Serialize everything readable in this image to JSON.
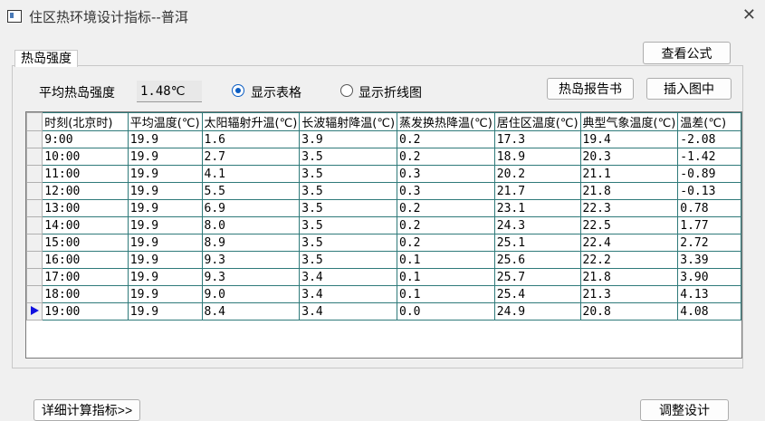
{
  "window": {
    "title": "住区热环境设计指标--普洱",
    "close_glyph": "✕"
  },
  "tab_label": "热岛强度",
  "avg_label": "平均热岛强度",
  "avg_value": "1.48℃",
  "radio_table_label": "显示表格",
  "radio_chart_label": "显示折线图",
  "selected_view": "table",
  "buttons": {
    "formula": "查看公式",
    "report": "热岛报告书",
    "insert": "插入图中",
    "details": "详细计算指标>>",
    "adjust": "调整设计"
  },
  "table": {
    "headers": [
      "时刻(北京时)",
      "平均温度(℃)",
      "太阳辐射升温(℃)",
      "长波辐射降温(℃)",
      "蒸发换热降温(℃)",
      "居住区温度(℃)",
      "典型气象温度(℃)",
      "温差(℃)"
    ],
    "rows": [
      [
        "9:00",
        "19.9",
        "1.6",
        "3.9",
        "0.2",
        "17.3",
        "19.4",
        "-2.08"
      ],
      [
        "10:00",
        "19.9",
        "2.7",
        "3.5",
        "0.2",
        "18.9",
        "20.3",
        "-1.42"
      ],
      [
        "11:00",
        "19.9",
        "4.1",
        "3.5",
        "0.3",
        "20.2",
        "21.1",
        "-0.89"
      ],
      [
        "12:00",
        "19.9",
        "5.5",
        "3.5",
        "0.3",
        "21.7",
        "21.8",
        "-0.13"
      ],
      [
        "13:00",
        "19.9",
        "6.9",
        "3.5",
        "0.2",
        "23.1",
        "22.3",
        "0.78"
      ],
      [
        "14:00",
        "19.9",
        "8.0",
        "3.5",
        "0.2",
        "24.3",
        "22.5",
        "1.77"
      ],
      [
        "15:00",
        "19.9",
        "8.9",
        "3.5",
        "0.2",
        "25.1",
        "22.4",
        "2.72"
      ],
      [
        "16:00",
        "19.9",
        "9.3",
        "3.5",
        "0.1",
        "25.6",
        "22.2",
        "3.39"
      ],
      [
        "17:00",
        "19.9",
        "9.3",
        "3.4",
        "0.1",
        "25.7",
        "21.8",
        "3.90"
      ],
      [
        "18:00",
        "19.9",
        "9.0",
        "3.4",
        "0.1",
        "25.4",
        "21.3",
        "4.13"
      ],
      [
        "19:00",
        "19.9",
        "8.4",
        "3.4",
        "0.0",
        "24.9",
        "20.8",
        "4.08"
      ]
    ],
    "current_row": 10
  },
  "colors": {
    "grid_line": "#2f7a7a",
    "radio_accent": "#0a5cc2",
    "row_arrow": "#1010e0"
  }
}
